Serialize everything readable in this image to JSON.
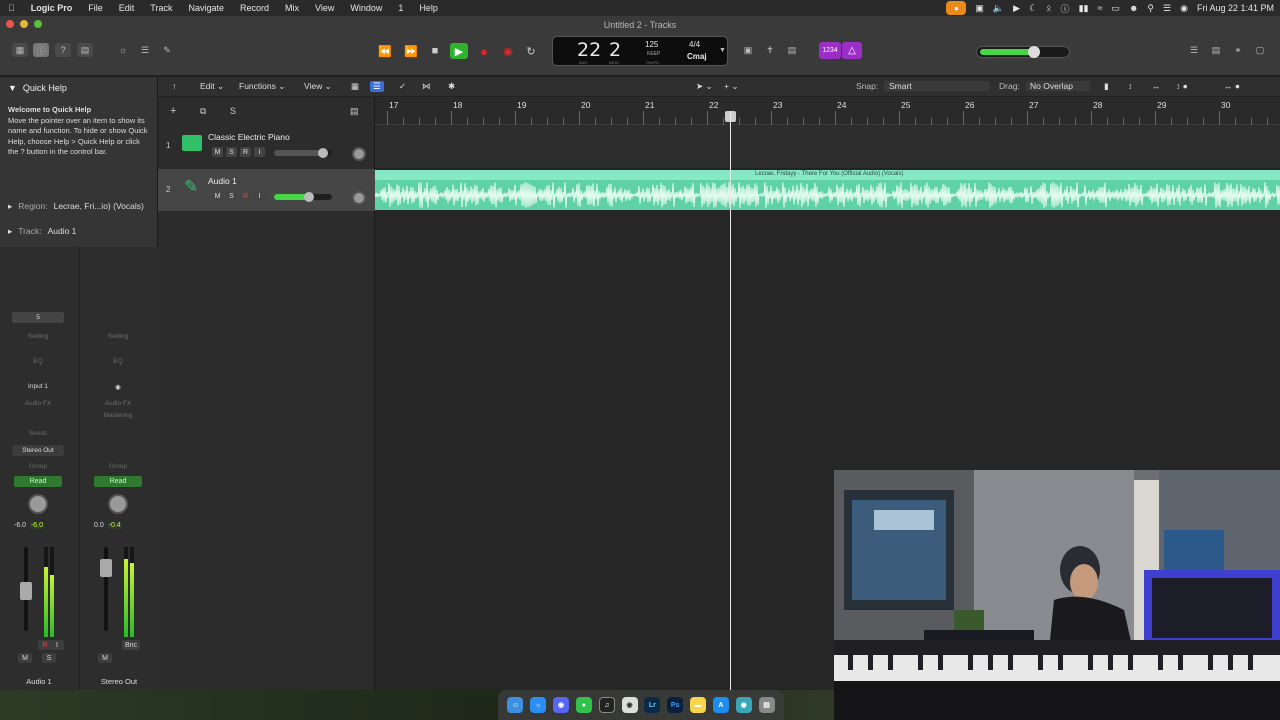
{
  "menubar": {
    "app_name": "Logic Pro",
    "items": [
      "File",
      "Edit",
      "Track",
      "Navigate",
      "Record",
      "Mix",
      "View",
      "Window",
      "1",
      "Help"
    ],
    "clock": "Fri Aug 22  1:41 PM"
  },
  "window": {
    "title": "Untitled 2 - Tracks"
  },
  "lcd": {
    "bar": "22",
    "beat": "2",
    "bar_label": "BAR",
    "beat_label": "BEAT",
    "tempo": "125",
    "tempo_mode": "KEEP",
    "tempo_label": "TEMPO",
    "time_signature": "4/4",
    "key": "Cmaj"
  },
  "count_in": {
    "label": "1234"
  },
  "master_volume": {
    "level": 0.65
  },
  "quick_help": {
    "header": "Quick Help",
    "title": "Welcome to Quick Help",
    "body": "Move the pointer over an item to show its name and function. To hide or show Quick Help, choose Help > Quick Help or click the ? button in the control bar."
  },
  "inspector": {
    "region_label": "Region:",
    "region_value": "Lecrae, Fri...io) (Vocals)",
    "track_label": "Track:",
    "track_value": "Audio 1"
  },
  "strips": [
    {
      "name": "Audio 1",
      "top_value": "5",
      "setting": "Setting",
      "eq": "EQ",
      "input": "Input 1",
      "fx": "Audio FX",
      "fx2": "",
      "sends": "Sends",
      "output": "Stereo Out",
      "group": "Group",
      "automation": "Read",
      "vol": "-6.0",
      "peak": "-6.0",
      "ms": [
        "M",
        "S"
      ],
      "ri": "R",
      "i": "I"
    },
    {
      "name": "Stereo Out",
      "top_value": "",
      "setting": "Setting",
      "eq": "EQ",
      "input": "",
      "fx": "Audio FX",
      "fx2": "Mastering",
      "sends": "",
      "output": "",
      "group": "Group",
      "automation": "Read",
      "vol": "0.0",
      "peak": "-0.4",
      "ms": [
        "M"
      ],
      "ri": "Bnc",
      "i": ""
    }
  ],
  "tracks_toolbar": {
    "edit": "Edit",
    "functions": "Functions",
    "view": "View",
    "snap_label": "Snap:",
    "snap_value": "Smart",
    "drag_label": "Drag:",
    "drag_value": "No Overlap"
  },
  "track_list_tools": {
    "add": "+",
    "s": "S"
  },
  "tracks": [
    {
      "num": "1",
      "name": "Classic Electric Piano",
      "m": "M",
      "s": "S",
      "r": "R",
      "i": "I",
      "volume": 0.85
    },
    {
      "num": "2",
      "name": "Audio 1",
      "m": "M",
      "s": "S",
      "r": "R",
      "i": "I",
      "volume": 0.6
    }
  ],
  "ruler": {
    "bars": [
      "17",
      "18",
      "19",
      "20",
      "21",
      "22",
      "23",
      "24",
      "25",
      "26",
      "27",
      "28",
      "29",
      "30"
    ]
  },
  "region": {
    "name": "Lecrae, Fridayy - There For You (Official Audio) (Vocals)"
  },
  "dock": {
    "apps": [
      "finder",
      "safari",
      "discord",
      "messages",
      "logic",
      "chrome",
      "Lr",
      "Ps",
      "notes",
      "appstore",
      "browser",
      "trash"
    ],
    "lr": "Lr",
    "ps": "Ps"
  },
  "colors": {
    "accent_green": "#2fb32f",
    "region": "#5ed1a6",
    "count_in": "#9a2ec7",
    "record": "#e0262b"
  }
}
